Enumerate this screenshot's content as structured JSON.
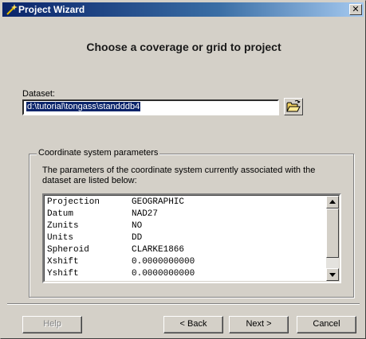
{
  "window": {
    "title": "Project Wizard",
    "close_glyph": "✕"
  },
  "heading": "Choose a coverage or grid to project",
  "dataset": {
    "label": "Dataset:",
    "value": "d:\\tutorial\\tongass\\standddb4"
  },
  "group": {
    "title": "Coordinate system parameters",
    "description": "The parameters of the coordinate system currently associated with the dataset are listed below:",
    "rows": [
      {
        "key": "Projection",
        "value": "GEOGRAPHIC"
      },
      {
        "key": "Datum",
        "value": "NAD27"
      },
      {
        "key": "Zunits",
        "value": "NO"
      },
      {
        "key": "Units",
        "value": "DD"
      },
      {
        "key": "Spheroid",
        "value": "CLARKE1866"
      },
      {
        "key": "Xshift",
        "value": "0.0000000000"
      },
      {
        "key": "Yshift",
        "value": "0.0000000000"
      }
    ]
  },
  "buttons": {
    "help": "Help",
    "back": "< Back",
    "next": "Next >",
    "cancel": "Cancel"
  },
  "colors": {
    "titlebar": "#0a246a",
    "selection": "#0a246a",
    "face": "#d4d0c8"
  },
  "icons": {
    "window": "wizard-wand-icon",
    "browse": "open-folder-icon"
  }
}
